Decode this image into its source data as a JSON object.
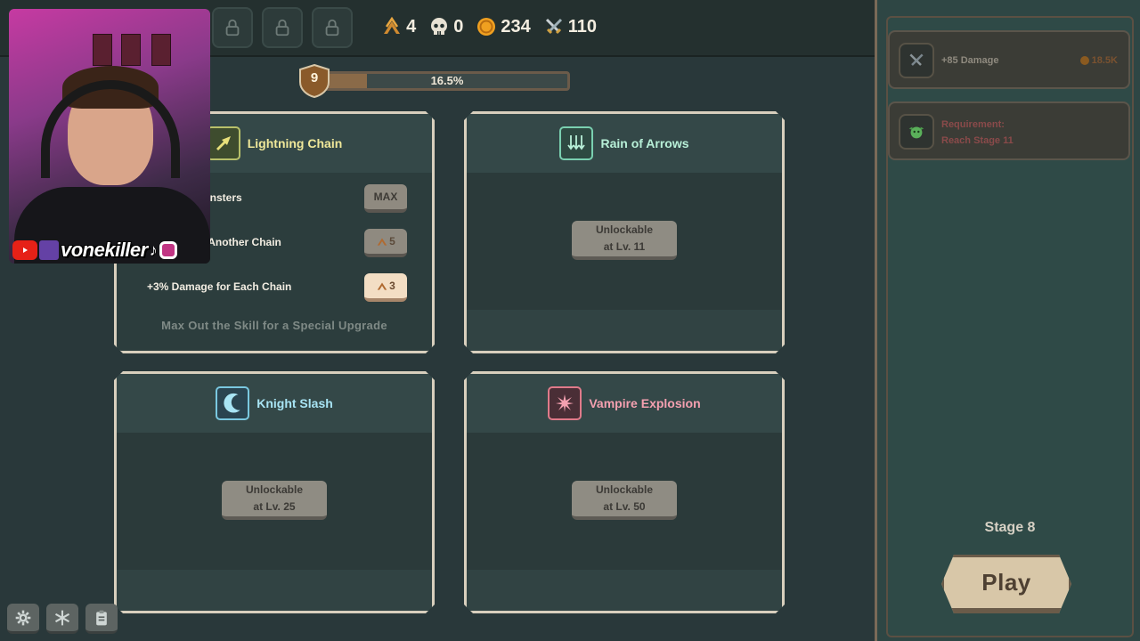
{
  "topbar": {
    "locked_tabs": [
      "lock-icon",
      "lock-icon",
      "lock-icon"
    ]
  },
  "currencies": {
    "rank": "4",
    "kills": "0",
    "gold": "234",
    "power": "110",
    "colors": {
      "gold": "#f0a020",
      "rank": "#d08a30"
    }
  },
  "level": {
    "value": "9",
    "progress_label": "16.5%",
    "progress_fraction": 0.165
  },
  "skills": {
    "lightning_chain": {
      "title": "Lightning Chain",
      "upgrades": [
        {
          "label": "dditional Monsters",
          "button": "MAX"
        },
        {
          "label": "e to Fork to Another Chain",
          "cost": "5"
        },
        {
          "label": "+3% Damage for Each Chain",
          "cost": "3"
        }
      ],
      "special": "Max Out the Skill for a Special Upgrade"
    },
    "rain_of_arrows": {
      "title": "Rain of Arrows",
      "unlock_line1": "Unlockable",
      "unlock_line2": "at Lv. 11"
    },
    "knight_slash": {
      "title": "Knight Slash",
      "unlock_line1": "Unlockable",
      "unlock_line2": "at Lv. 25"
    },
    "vampire_explosion": {
      "title": "Vampire Explosion",
      "unlock_line1": "Unlockable",
      "unlock_line2": "at Lv. 50"
    }
  },
  "side": {
    "items": [
      {
        "text": "+85 Damage",
        "price": "18.5K"
      },
      {
        "text_line1": "Requirement:",
        "text_line2": "Reach Stage 11"
      }
    ],
    "stage": "Stage 8",
    "play": "Play"
  },
  "webcam": {
    "handle": "vonekiller"
  }
}
